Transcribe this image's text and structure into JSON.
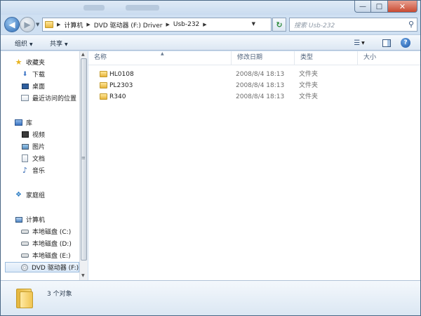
{
  "window": {
    "caption_buttons": {
      "minimize": "minimize-icon",
      "maximize": "maximize-icon",
      "close": "close-icon"
    },
    "accent": "#2d6bb5"
  },
  "address_bar": {
    "breadcrumbs": [
      "计算机",
      "DVD 驱动器 (F:) Driver",
      "Usb-232"
    ]
  },
  "search": {
    "placeholder": "搜索 Usb-232"
  },
  "toolbar": {
    "organize_label": "组织",
    "share_label": "共享"
  },
  "navigation": {
    "favorites": {
      "label": "收藏夹",
      "items": [
        {
          "label": "下载",
          "icon": "download-folder-icon"
        },
        {
          "label": "桌面",
          "icon": "desktop-icon"
        },
        {
          "label": "最近访问的位置",
          "icon": "recent-places-icon"
        }
      ]
    },
    "libraries": {
      "label": "库",
      "items": [
        {
          "label": "视频",
          "icon": "video-icon"
        },
        {
          "label": "图片",
          "icon": "picture-icon"
        },
        {
          "label": "文档",
          "icon": "document-icon"
        },
        {
          "label": "音乐",
          "icon": "music-icon"
        }
      ]
    },
    "homegroup": {
      "label": "家庭组"
    },
    "computer": {
      "label": "计算机",
      "items": [
        {
          "label": "本地磁盘 (C:)"
        },
        {
          "label": "本地磁盘 (D:)"
        },
        {
          "label": "本地磁盘 (E:)"
        },
        {
          "label": "DVD 驱动器 (F:)",
          "selected": true
        }
      ]
    }
  },
  "file_list": {
    "columns": [
      "名称",
      "修改日期",
      "类型",
      "大小"
    ],
    "rows": [
      {
        "name": "HL0108",
        "date": "2008/8/4 18:13",
        "type": "文件夹",
        "size": ""
      },
      {
        "name": "PL2303",
        "date": "2008/8/4 18:13",
        "type": "文件夹",
        "size": ""
      },
      {
        "name": "R340",
        "date": "2008/8/4 18:13",
        "type": "文件夹",
        "size": ""
      }
    ]
  },
  "details": {
    "item_count": "3 个对象"
  }
}
